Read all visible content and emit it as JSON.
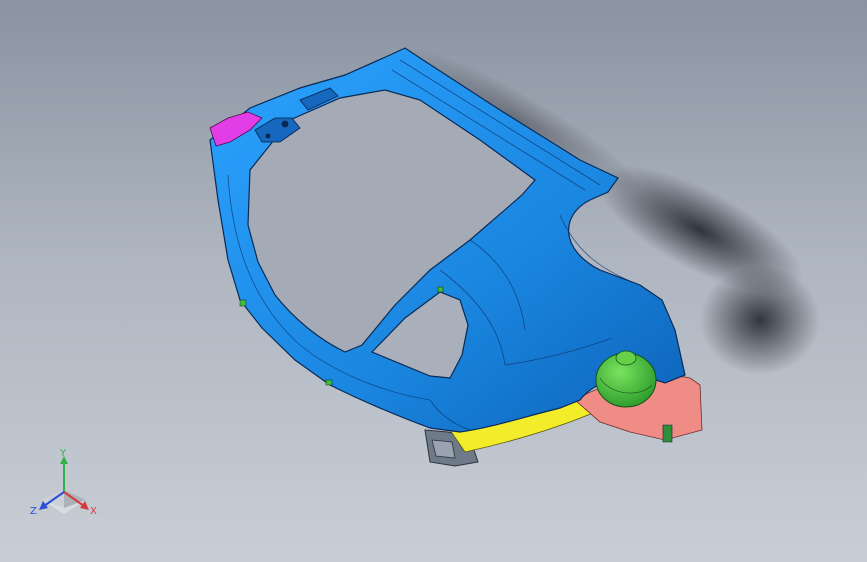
{
  "viewport": {
    "background_top": "#8a93a1",
    "background_bottom": "#c9ced6"
  },
  "model": {
    "body_color": "#1e8fe6",
    "body_dark": "#0f5aa8",
    "accent_magenta": "#e23de6",
    "accent_yellow": "#f2ec2a",
    "accent_pink": "#f08c86",
    "accent_green": "#3fbf35",
    "bracket_gray": "#7d8796"
  },
  "triad": {
    "x_label": "X",
    "y_label": "Y",
    "z_label": "Z",
    "x_color": "#d63a3a",
    "y_color": "#2fb24a",
    "z_color": "#2b4fd8"
  }
}
